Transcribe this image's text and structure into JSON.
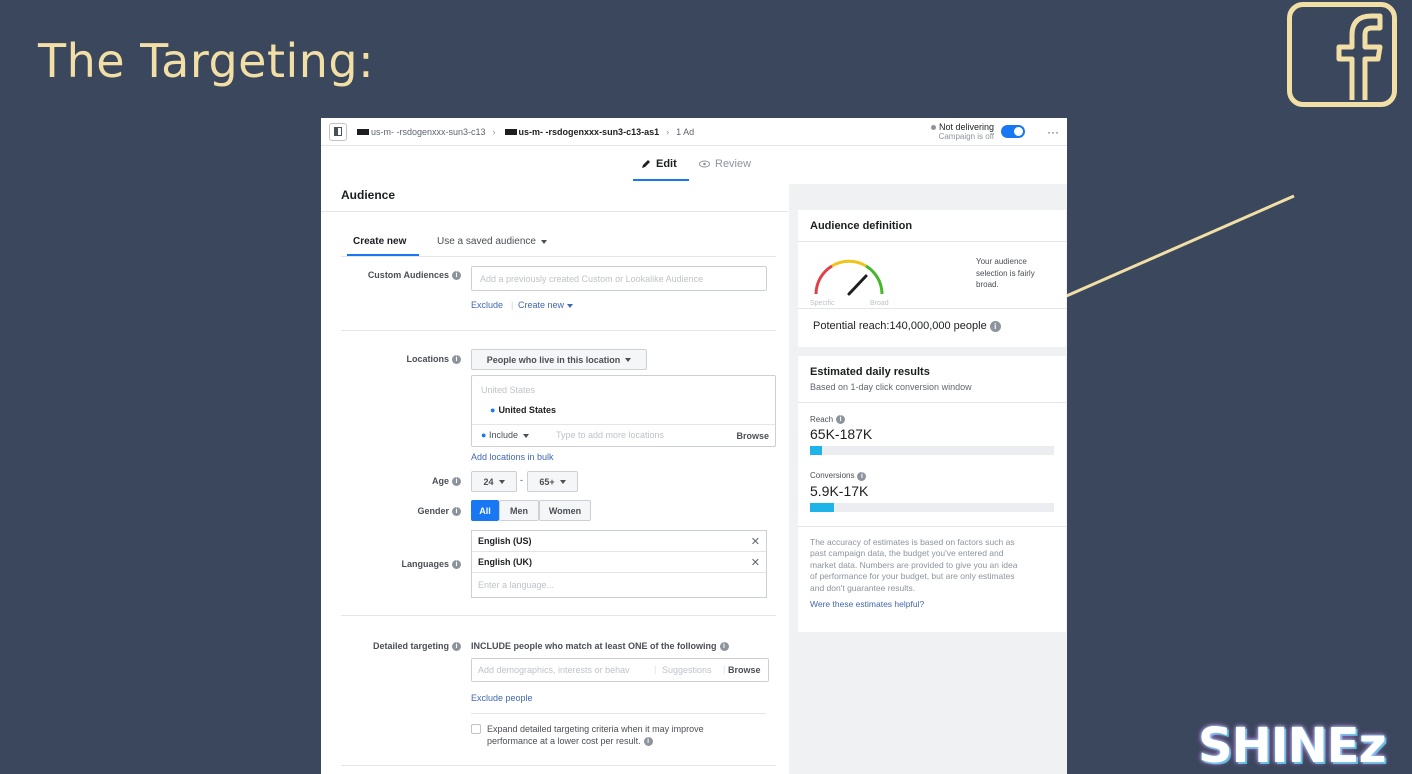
{
  "slide": {
    "title": "The Targeting:",
    "brand": "SHINEz",
    "colors": {
      "background": "#3a475d",
      "accent": "#f2dfa6"
    }
  },
  "topbar": {
    "campaign": "us-m-  -rsdogenxxx-sun3-c13",
    "adset": "us-m-  -rsdogenxxx-sun3-c13-as1",
    "ad_count": "1 Ad",
    "status": "Not delivering",
    "status_sub": "Campaign is off",
    "more": "···"
  },
  "tabs": {
    "edit": "Edit",
    "review": "Review"
  },
  "audience": {
    "title": "Audience",
    "subtabs": {
      "create_new": "Create new",
      "use_saved": "Use a saved audience"
    },
    "custom_audiences": {
      "label": "Custom Audiences",
      "placeholder": "Add a previously created Custom or Lookalike Audience",
      "exclude": "Exclude",
      "create_new": "Create new"
    },
    "locations": {
      "label": "Locations",
      "dropdown": "People who live in this location",
      "group": "United States",
      "selected": "United States",
      "include": "Include",
      "input_placeholder": "Type to add more locations",
      "browse": "Browse",
      "bulk_link": "Add locations in bulk"
    },
    "age": {
      "label": "Age",
      "min": "24",
      "max": "65+",
      "separator": "-"
    },
    "gender": {
      "label": "Gender",
      "options": [
        "All",
        "Men",
        "Women"
      ]
    },
    "languages": {
      "label": "Languages",
      "selected": [
        "English (US)",
        "English (UK)"
      ],
      "placeholder": "Enter a language..."
    },
    "detailed": {
      "label": "Detailed targeting",
      "include_text": "INCLUDE people who match at least ONE of the following",
      "placeholder": "Add demographics, interests or behav",
      "suggestions": "Suggestions",
      "browse": "Browse",
      "exclude_link": "Exclude people",
      "expand_text_1": "Expand detailed targeting criteria when it may improve",
      "expand_text_2": "performance at a lower cost per result."
    }
  },
  "audience_definition": {
    "title": "Audience definition",
    "gauge_left": "Specific",
    "gauge_right": "Broad",
    "note": [
      "Your audience",
      "selection is fairly",
      "broad."
    ],
    "reach_text": "Potential reach:140,000,000 people"
  },
  "estimated": {
    "title": "Estimated daily results",
    "subtitle": "Based on 1-day click conversion window",
    "reach_label": "Reach",
    "reach_value": "65K-187K",
    "reach_fill_fraction": 0.05,
    "conv_label": "Conversions",
    "conv_value": "5.9K-17K",
    "conv_fill_fraction": 0.1,
    "disclaimer": [
      "The accuracy of estimates is based on factors such as",
      "past campaign data, the budget you've entered and",
      "market data. Numbers are provided to give you an idea",
      "of performance for your budget, but are only estimates",
      "and don't guarantee results."
    ],
    "helpful_link": "Were these estimates helpful?"
  }
}
